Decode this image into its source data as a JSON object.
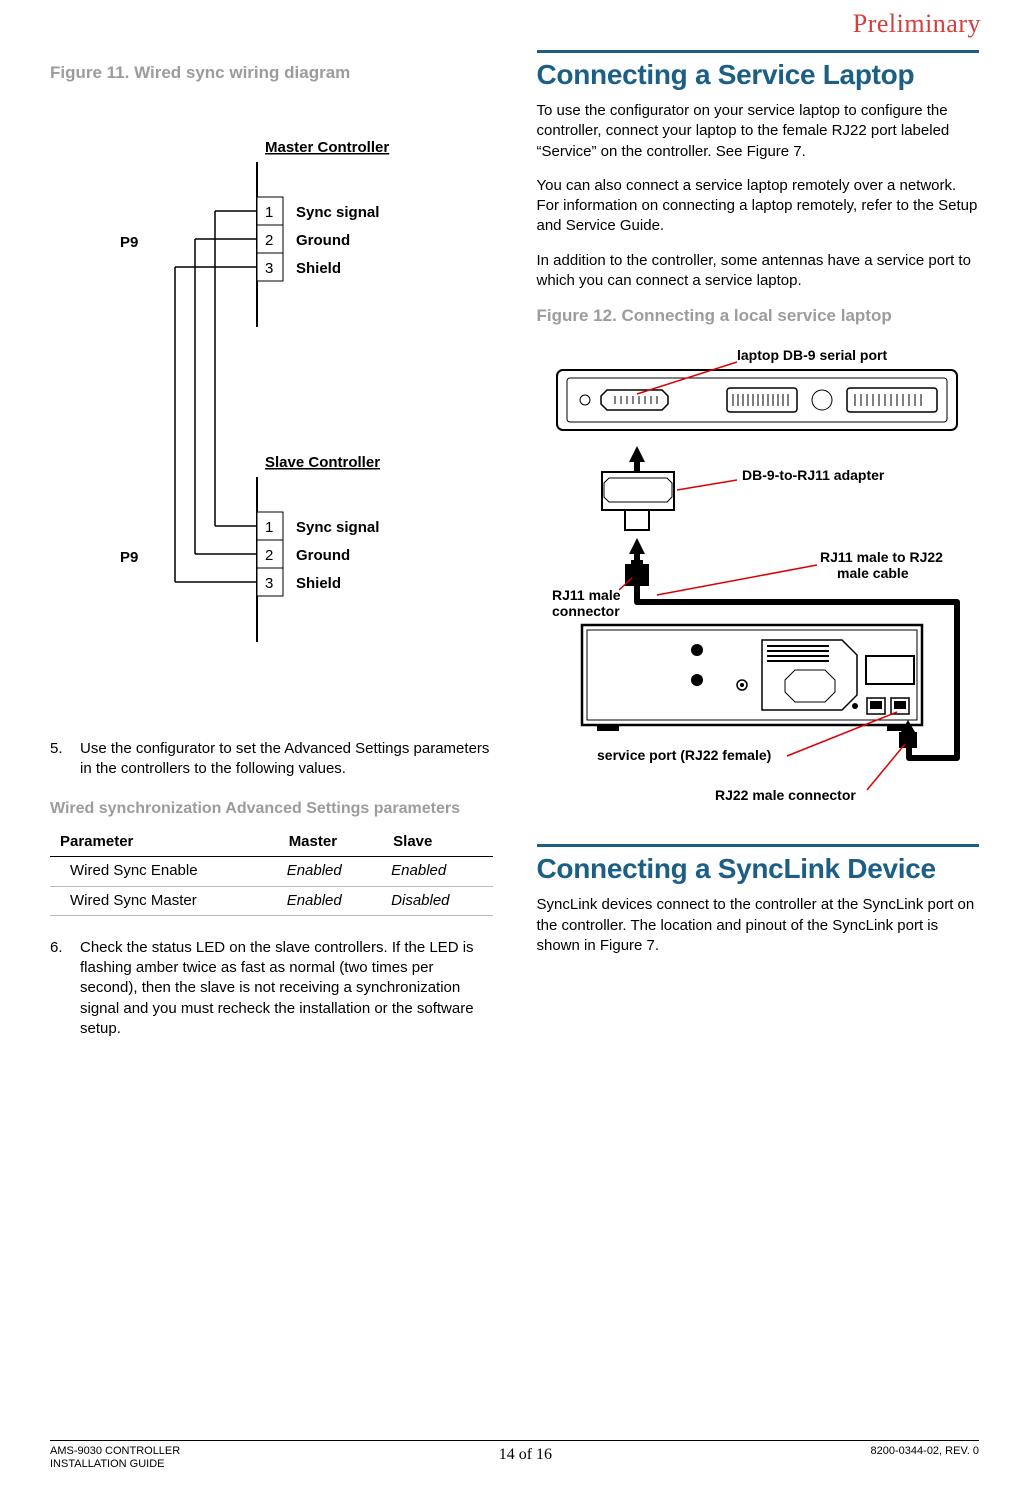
{
  "watermark": "Preliminary",
  "left": {
    "fig11_caption": "Figure 11. Wired sync wiring diagram",
    "diagram": {
      "p9": "P9",
      "master_title": "Master Controller",
      "slave_title": "Slave Controller",
      "pin1": "1",
      "pin2": "2",
      "pin3": "3",
      "sig1": "Sync signal",
      "sig2": "Ground",
      "sig3": "Shield"
    },
    "step5_num": "5.",
    "step5_body": "Use the configurator to set the Advanced Settings parameters in the controllers to the following values.",
    "table_caption": "Wired synchronization Advanced Settings parameters",
    "table": {
      "hdr_param": "Parameter",
      "hdr_master": "Master",
      "hdr_slave": "Slave",
      "row1_param": "Wired Sync Enable",
      "row1_master": "Enabled",
      "row1_slave": "Enabled",
      "row2_param": "Wired Sync Master",
      "row2_master": "Enabled",
      "row2_slave": "Disabled"
    },
    "step6_num": "6.",
    "step6_body": "Check the status LED on the slave controllers. If the LED is flashing amber twice as fast as normal (two times per second), then the slave is not receiving a synchronization signal and you must recheck the installation or the software setup."
  },
  "right": {
    "sec1_title": "Connecting a Service Laptop",
    "p1": "To use the configurator on your service laptop to configure the controller, connect your laptop to the female RJ22 port labeled “Service” on the controller. See Figure 7.",
    "p2": "You can also connect a service laptop remotely over a network. For information on connecting a laptop remotely, refer to the Setup and Service Guide.",
    "p3": "In addition to the controller, some antennas have a service port to which you can connect a service laptop.",
    "fig12_caption": "Figure 12. Connecting a local service laptop",
    "labels": {
      "laptop_port": "laptop DB-9 serial port",
      "adapter": "DB-9-to-RJ11 adapter",
      "cable": "RJ11 male to RJ22 male cable",
      "rj11_conn": "RJ11 male connector",
      "service_port": "service port (RJ22 female)",
      "rj22_conn": "RJ22 male connector"
    },
    "sec2_title": "Connecting a SyncLink Device",
    "p4": "SyncLink devices connect to the controller at the SyncLink port on the controller. The location and pinout of the SyncLink port is shown in Figure 7."
  },
  "footer": {
    "left": "AMS-9030 CONTROLLER\nINSTALLATION GUIDE",
    "center": "14 of 16",
    "right": "8200-0344-02, REV. 0"
  }
}
